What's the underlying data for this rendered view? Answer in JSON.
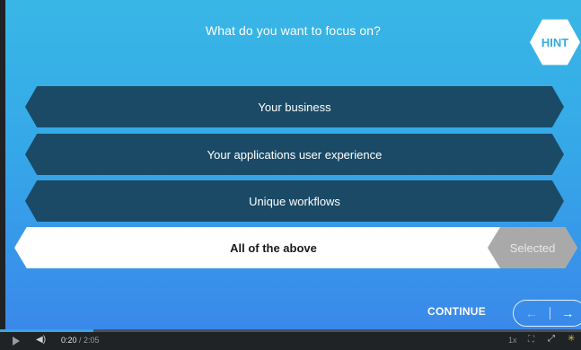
{
  "question": "What do you want to focus on?",
  "hint_label": "HINT",
  "options": [
    {
      "label": "Your business"
    },
    {
      "label": "Your applications user experience"
    },
    {
      "label": "Unique workflows"
    },
    {
      "label": "All of the above",
      "badge": "Selected"
    }
  ],
  "continue_label": "CONTINUE",
  "nav": {
    "prev_icon": "←",
    "next_icon": "→"
  },
  "player": {
    "current_time": "0:20",
    "duration": "/ 2:05",
    "speed": "1x",
    "progress_fraction": 0.16,
    "volume_icon": "◀)",
    "settings_icon": "⛶",
    "fullscreen_icon": "⤢",
    "loader_icon": "✳"
  },
  "colors": {
    "option_bg": "#1a4a66",
    "selected_bg": "#ffffff",
    "badge_bg": "#a9a9a9",
    "accent": "#36a9e2"
  }
}
